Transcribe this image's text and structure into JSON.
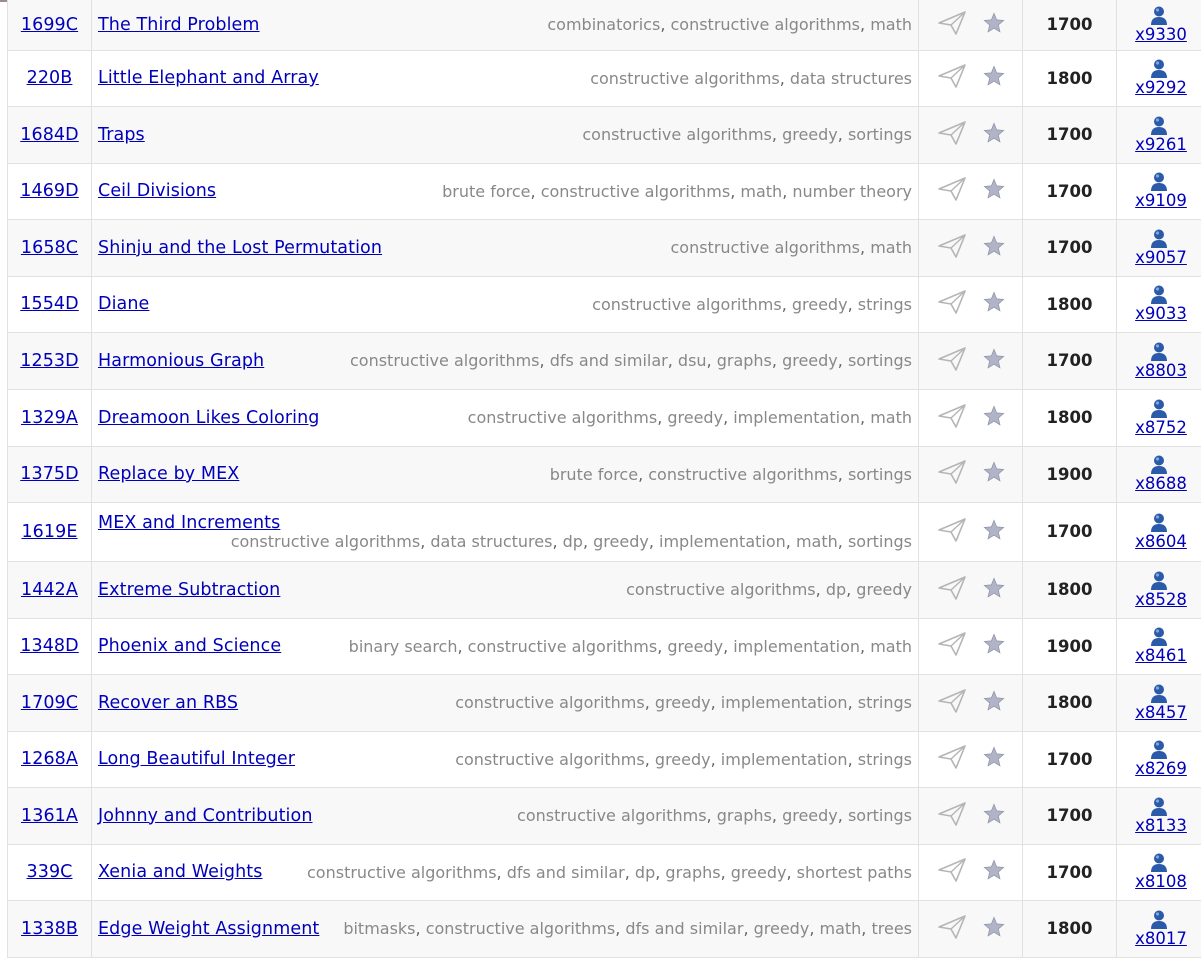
{
  "problems": [
    {
      "id": "1699C",
      "name": "The Third Problem",
      "tags": [
        "combinatorics",
        "constructive algorithms",
        "math"
      ],
      "rating": "1700",
      "solved": "x9330"
    },
    {
      "id": "220B",
      "name": "Little Elephant and Array",
      "tags": [
        "constructive algorithms",
        "data structures"
      ],
      "rating": "1800",
      "solved": "x9292"
    },
    {
      "id": "1684D",
      "name": "Traps",
      "tags": [
        "constructive algorithms",
        "greedy",
        "sortings"
      ],
      "rating": "1700",
      "solved": "x9261"
    },
    {
      "id": "1469D",
      "name": "Ceil Divisions",
      "tags": [
        "brute force",
        "constructive algorithms",
        "math",
        "number theory"
      ],
      "rating": "1700",
      "solved": "x9109"
    },
    {
      "id": "1658C",
      "name": "Shinju and the Lost Permutation",
      "tags": [
        "constructive algorithms",
        "math"
      ],
      "rating": "1700",
      "solved": "x9057"
    },
    {
      "id": "1554D",
      "name": "Diane",
      "tags": [
        "constructive algorithms",
        "greedy",
        "strings"
      ],
      "rating": "1800",
      "solved": "x9033"
    },
    {
      "id": "1253D",
      "name": "Harmonious Graph",
      "tags": [
        "constructive algorithms",
        "dfs and similar",
        "dsu",
        "graphs",
        "greedy",
        "sortings"
      ],
      "rating": "1700",
      "solved": "x8803"
    },
    {
      "id": "1329A",
      "name": "Dreamoon Likes Coloring",
      "tags": [
        "constructive algorithms",
        "greedy",
        "implementation",
        "math"
      ],
      "rating": "1800",
      "solved": "x8752"
    },
    {
      "id": "1375D",
      "name": "Replace by MEX",
      "tags": [
        "brute force",
        "constructive algorithms",
        "sortings"
      ],
      "rating": "1900",
      "solved": "x8688"
    },
    {
      "id": "1619E",
      "name": "MEX and Increments",
      "tags": [
        "constructive algorithms",
        "data structures",
        "dp",
        "greedy",
        "implementation",
        "math",
        "sortings"
      ],
      "rating": "1700",
      "solved": "x8604",
      "wrap": true
    },
    {
      "id": "1442A",
      "name": "Extreme Subtraction",
      "tags": [
        "constructive algorithms",
        "dp",
        "greedy"
      ],
      "rating": "1800",
      "solved": "x8528"
    },
    {
      "id": "1348D",
      "name": "Phoenix and Science",
      "tags": [
        "binary search",
        "constructive algorithms",
        "greedy",
        "implementation",
        "math"
      ],
      "rating": "1900",
      "solved": "x8461"
    },
    {
      "id": "1709C",
      "name": "Recover an RBS",
      "tags": [
        "constructive algorithms",
        "greedy",
        "implementation",
        "strings"
      ],
      "rating": "1800",
      "solved": "x8457"
    },
    {
      "id": "1268A",
      "name": "Long Beautiful Integer",
      "tags": [
        "constructive algorithms",
        "greedy",
        "implementation",
        "strings"
      ],
      "rating": "1700",
      "solved": "x8269"
    },
    {
      "id": "1361A",
      "name": "Johnny and Contribution",
      "tags": [
        "constructive algorithms",
        "graphs",
        "greedy",
        "sortings"
      ],
      "rating": "1700",
      "solved": "x8133"
    },
    {
      "id": "339C",
      "name": "Xenia and Weights",
      "tags": [
        "constructive algorithms",
        "dfs and similar",
        "dp",
        "graphs",
        "greedy",
        "shortest paths"
      ],
      "rating": "1700",
      "solved": "x8108"
    },
    {
      "id": "1338B",
      "name": "Edge Weight Assignment",
      "tags": [
        "bitmasks",
        "constructive algorithms",
        "dfs and similar",
        "greedy",
        "math",
        "trees"
      ],
      "rating": "1800",
      "solved": "x8017"
    }
  ],
  "icons": {
    "submit": "paper-plane-icon",
    "favourite": "star-icon",
    "solved": "user-icon"
  },
  "colors": {
    "link": "#0000bb",
    "tag": "#888888",
    "row_alt": "#f8f8f8",
    "user_icon": "#2b5aa8"
  }
}
